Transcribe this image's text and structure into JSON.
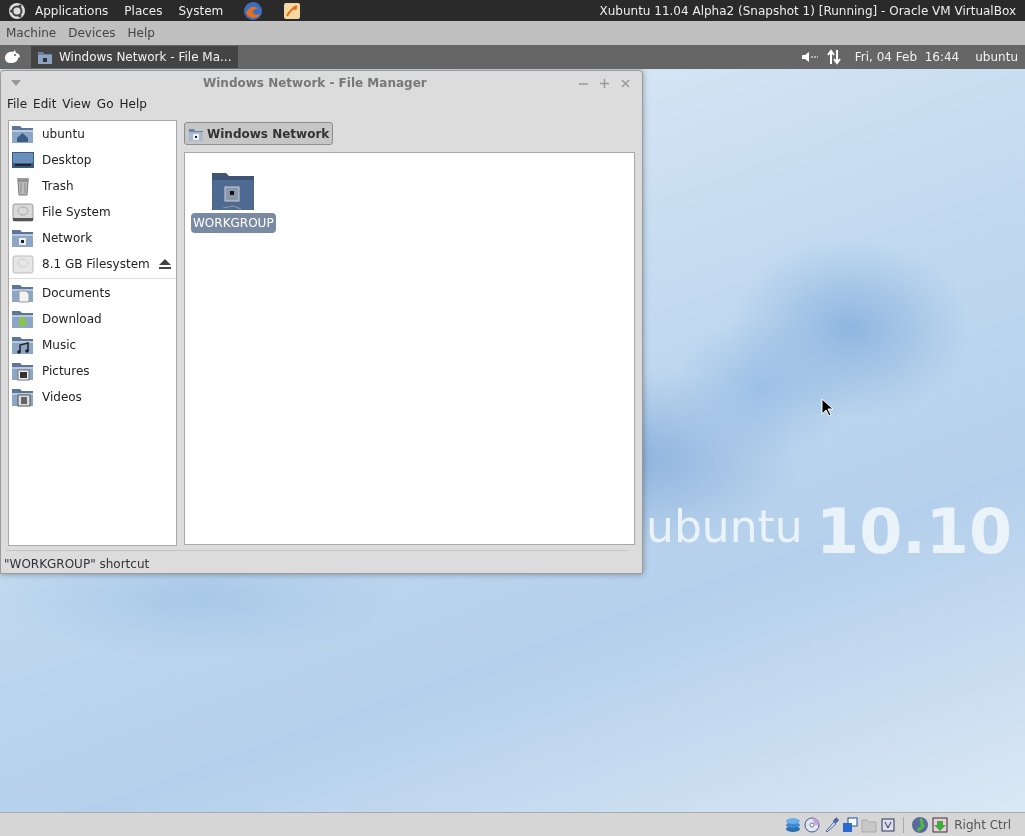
{
  "host_window": {
    "title": "Xubuntu 11.04 Alpha2 (Snapshot 1) [Running] - Oracle VM VirtualBox",
    "menu": [
      "Applications",
      "Places",
      "System"
    ]
  },
  "vbox_menu": [
    "Machine",
    "Devices",
    "Help"
  ],
  "guest_panel": {
    "tasks": [
      {
        "label": "Windows Network - File Ma...",
        "selected": true
      }
    ],
    "clock": "Fri, 04 Feb  16:44",
    "user": "ubuntu"
  },
  "file_manager": {
    "title": "Windows Network - File Manager",
    "menu": [
      "File",
      "Edit",
      "View",
      "Go",
      "Help"
    ],
    "sidebar": {
      "devices": [
        {
          "label": "ubuntu",
          "kind": "home",
          "ejectable": false
        },
        {
          "label": "Desktop",
          "kind": "desktop",
          "ejectable": false
        },
        {
          "label": "Trash",
          "kind": "trash",
          "ejectable": false
        },
        {
          "label": "File System",
          "kind": "drive",
          "ejectable": false
        },
        {
          "label": "Network",
          "kind": "network",
          "ejectable": false
        },
        {
          "label": "8.1 GB Filesystem",
          "kind": "removable",
          "ejectable": true
        }
      ],
      "places": [
        {
          "label": "Documents",
          "kind": "documents"
        },
        {
          "label": "Download",
          "kind": "download"
        },
        {
          "label": "Music",
          "kind": "music"
        },
        {
          "label": "Pictures",
          "kind": "pictures"
        },
        {
          "label": "Videos",
          "kind": "videos"
        }
      ]
    },
    "path": [
      {
        "label": "Windows Network",
        "selected": true
      }
    ],
    "items": [
      {
        "label": "WORKGROUP",
        "selected": true
      }
    ],
    "status": "\"WORKGROUP\" shortcut"
  },
  "wallpaper": {
    "brand": "ubuntu",
    "version": "10.10"
  },
  "vbox_status": {
    "host_key": "Right Ctrl"
  }
}
